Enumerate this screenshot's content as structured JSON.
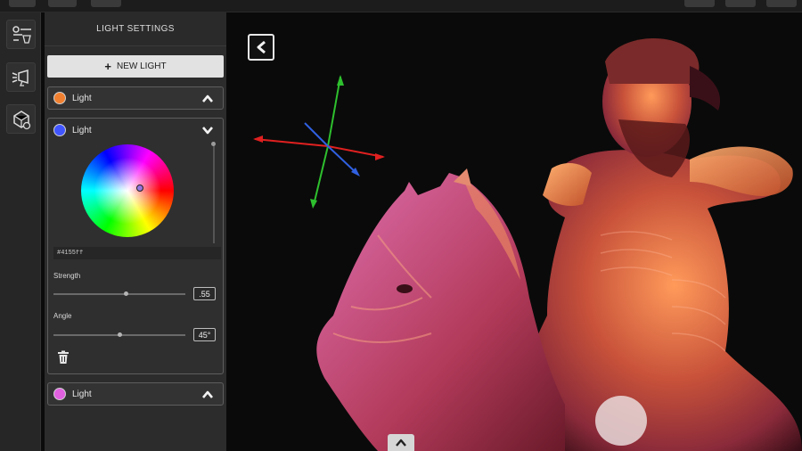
{
  "panel": {
    "title": "LIGHT SETTINGS",
    "new_light_label": "NEW LIGHT",
    "lights": [
      {
        "label": "Light",
        "color": "#f08030",
        "state": "collapsed"
      },
      {
        "label": "Light",
        "color": "#4155ff",
        "state": "expanded"
      },
      {
        "label": "Light",
        "color": "#e060e0",
        "state": "collapsed"
      }
    ],
    "editor": {
      "hex_value": "#4155ff",
      "strength_label": "Strength",
      "strength_value": ".55",
      "strength_fraction": 0.55,
      "angle_label": "Angle",
      "angle_value": "45°",
      "angle_fraction": 0.5
    }
  },
  "rail": {
    "tools": [
      {
        "icon": "light-settings-icon"
      },
      {
        "icon": "spotlight-icon"
      },
      {
        "icon": "environment-icon"
      }
    ]
  },
  "viewport": {
    "back_icon": "chevron-left-icon",
    "gizmo_icon": "transform-gizmo-icon",
    "handle_icon": "light-position-handle-icon",
    "bottom_icon": "chevron-up-icon"
  }
}
